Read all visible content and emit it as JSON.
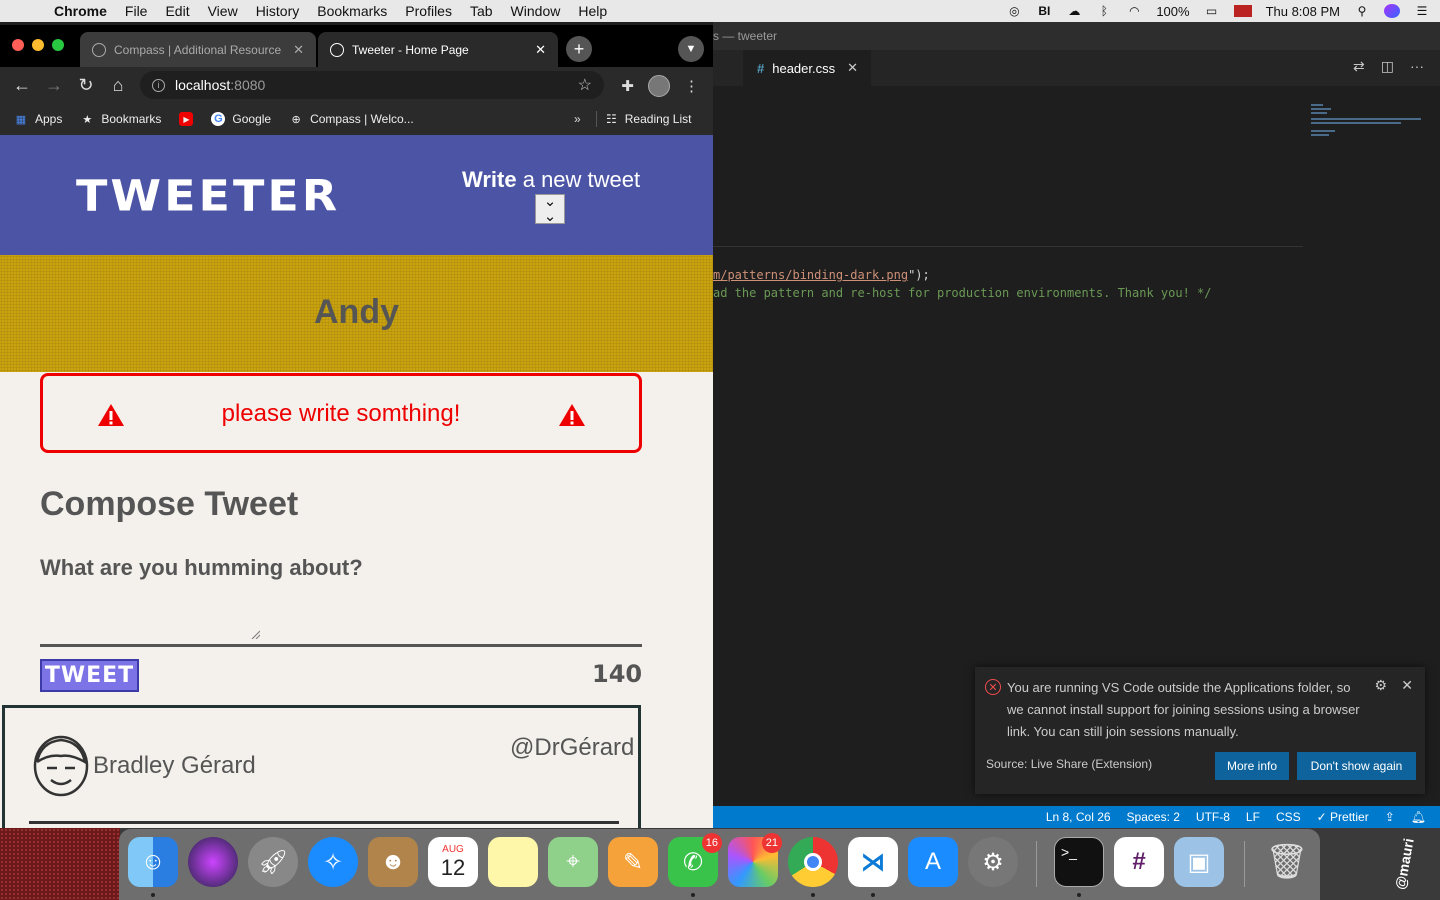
{
  "menubar": {
    "app_name": "Chrome",
    "items": [
      "File",
      "Edit",
      "View",
      "History",
      "Bookmarks",
      "Profiles",
      "Tab",
      "Window",
      "Help"
    ],
    "battery": "100%",
    "clock": "Thu 8:08 PM"
  },
  "vscode": {
    "title": "s — tweeter",
    "tab_label": "header.css",
    "code_line1_str": "m/patterns/binding-dark.png",
    "code_line1_tail": "\");",
    "code_line2": "ad the pattern and re-host for production environments. Thank you! */",
    "status": [
      "Ln 8, Col 26",
      "Spaces: 2",
      "UTF-8",
      "LF",
      "CSS",
      "✓ Prettier"
    ],
    "notification": {
      "message": "You are running VS Code outside the Applications folder, so we cannot install support for joining sessions using a browser link. You can still join sessions manually.",
      "source": "Source: Live Share (Extension)",
      "more_info": "More info",
      "dont_show": "Don't show again"
    }
  },
  "chrome": {
    "tabs": [
      {
        "label": "Compass | Additional Resource",
        "active": false
      },
      {
        "label": "Tweeter - Home Page",
        "active": true
      }
    ],
    "url_host": "localhost",
    "url_port": ":8080",
    "bookmarks": [
      "Apps",
      "Bookmarks",
      "",
      "Google",
      "Compass | Welco..."
    ],
    "reading_list": "Reading List"
  },
  "page": {
    "logo": "TWEETER",
    "write_bold": "Write",
    "write_rest": " a new tweet",
    "username": "Andy",
    "error": "please write somthing!",
    "compose_title": "Compose Tweet",
    "compose_label": "What are you humming about?",
    "tweet_button": "TWEET",
    "counter": "140",
    "tweet": {
      "name": "Bradley Gérard",
      "handle": "@DrGérard"
    }
  },
  "dock": {
    "badges": {
      "facetime": "16",
      "photos": "21"
    },
    "calendar_month": "AUG",
    "calendar_day": "12"
  },
  "signature": "@mauri"
}
